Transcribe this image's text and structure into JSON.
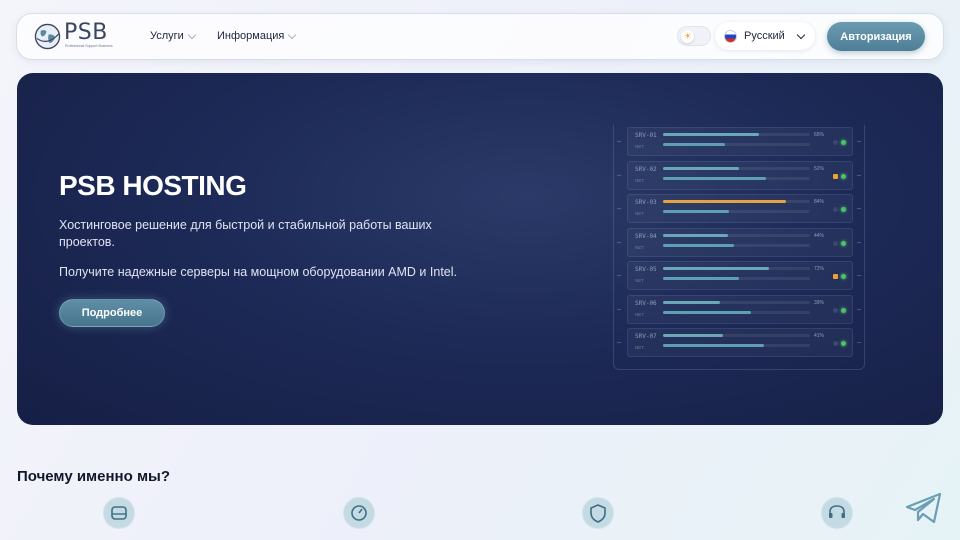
{
  "header": {
    "logo_text": "PSB",
    "logo_sub": "Professional Support Business",
    "nav": [
      {
        "label": "Услуги"
      },
      {
        "label": "Информация"
      }
    ],
    "language": "Русский",
    "auth_label": "Авторизация"
  },
  "hero": {
    "title": "PSB HOSTING",
    "p1": "Хостинговое решение для быстрой и стабильной работы ваших проектов.",
    "p2": "Получите надежные серверы на мощном оборудовании AMD и Intel.",
    "button": "Подробнее",
    "servers": [
      {
        "name": "SRV-01",
        "net": "NET",
        "load": 65,
        "net_load": 42,
        "warn": false,
        "led_orange": false
      },
      {
        "name": "SRV-02",
        "net": "NET",
        "load": 52,
        "net_load": 70,
        "warn": false,
        "led_orange": true
      },
      {
        "name": "SRV-03",
        "net": "NET",
        "load": 84,
        "net_load": 45,
        "warn": true,
        "led_orange": false
      },
      {
        "name": "SRV-04",
        "net": "NET",
        "load": 44,
        "net_load": 48,
        "warn": false,
        "led_orange": false
      },
      {
        "name": "SRV-05",
        "net": "NET",
        "load": 72,
        "net_load": 52,
        "warn": false,
        "led_orange": true
      },
      {
        "name": "SRV-06",
        "net": "NET",
        "load": 39,
        "net_load": 60,
        "warn": false,
        "led_orange": false
      },
      {
        "name": "SRV-07",
        "net": "NET",
        "load": 41,
        "net_load": 69,
        "warn": false,
        "led_orange": false
      }
    ]
  },
  "why": {
    "title": "Почему именно мы?",
    "features": [
      {
        "icon": "drive-icon"
      },
      {
        "icon": "speed-icon"
      },
      {
        "icon": "shield-icon"
      },
      {
        "icon": "headset-icon"
      }
    ]
  },
  "colors": {
    "accent": "#5a8aa2",
    "hero_bg": "#1d2a57",
    "warn": "#e8a23d",
    "ok": "#4fc06a"
  }
}
